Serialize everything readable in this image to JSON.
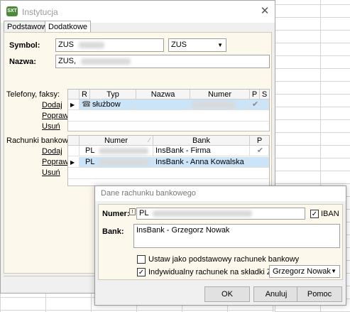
{
  "window": {
    "title": "Instytucja",
    "app_icon_text": "SXT"
  },
  "tabs": [
    {
      "label": "Podstawowe"
    },
    {
      "label": "Dodatkowe"
    }
  ],
  "form": {
    "symbol_label": "Symbol:",
    "symbol_value": "ZUS",
    "symbol_type": "ZUS",
    "nazwa_label": "Nazwa:",
    "nazwa_value": "ZUS,"
  },
  "phones": {
    "section_label": "Telefony, faksy:",
    "actions": [
      "Dodaj",
      "Popraw",
      "Usuń"
    ],
    "columns": [
      "R",
      "Typ",
      "Nazwa",
      "Numer",
      "P",
      "S"
    ],
    "rows": [
      {
        "typ": "służbow",
        "p_checked": true
      }
    ]
  },
  "accounts": {
    "section_label": "Rachunki bankowe:",
    "actions": [
      "Dodaj",
      "Popraw",
      "Usuń"
    ],
    "columns": [
      "Numer",
      "Bank",
      "P"
    ],
    "rows": [
      {
        "numer": "PL",
        "bank": "InsBank - Firma",
        "p_checked": true
      },
      {
        "numer": "PL",
        "bank": "InsBank - Anna Kowalska",
        "p_checked": false
      }
    ]
  },
  "dialog": {
    "title": "Dane rachunku bankowego",
    "numer_label": "Numer:",
    "numer_value": "PL",
    "iban_label": "IBAN",
    "iban_checked": true,
    "bank_label": "Bank:",
    "bank_value": "InsBank - Grzegorz Nowak",
    "default_account_label": "Ustaw jako podstawowy rachunek bankowy",
    "default_account_checked": false,
    "individual_label": "Indywidualny rachunek na składki ZUS dla:",
    "individual_checked": true,
    "individual_person": "Grzegorz Nowak",
    "buttons": {
      "ok": "OK",
      "cancel": "Anuluj",
      "help": "Pomoc"
    }
  }
}
